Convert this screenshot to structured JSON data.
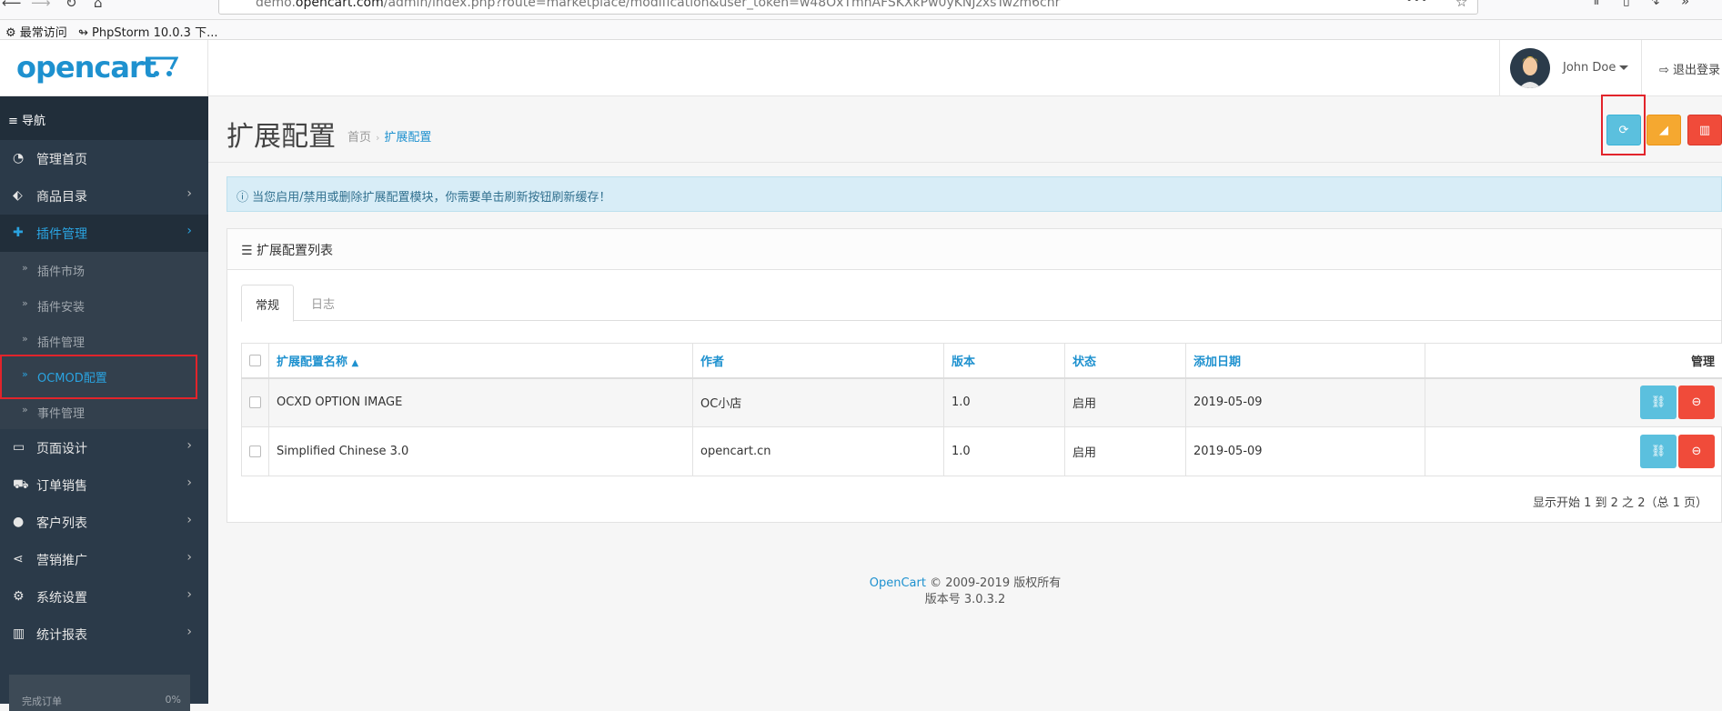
{
  "browser": {
    "url_prefix": "demo.",
    "url_host": "opencart.com",
    "url_path": "/admin/index.php?route=marketplace/modification&user_token=w48OxTmnAFSKXkPw0yKNJzxsTwzm6chr",
    "bookmarks": [
      {
        "label": "最常访问",
        "icon": "gear-icon"
      },
      {
        "label": "PhpStorm 10.0.3 下...",
        "icon": "phpstorm-icon"
      }
    ]
  },
  "header": {
    "logo": "opencart",
    "user_name": "John Doe",
    "logout_label": "退出登录"
  },
  "sidebar": {
    "nav_title": "导航",
    "items": [
      {
        "label": "管理首页",
        "icon": "dashboard-icon",
        "has_children": false
      },
      {
        "label": "商品目录",
        "icon": "tags-icon",
        "has_children": true
      },
      {
        "label": "插件管理",
        "icon": "puzzle-icon",
        "has_children": true,
        "active": true
      },
      {
        "label": "页面设计",
        "icon": "monitor-icon",
        "has_children": true
      },
      {
        "label": "订单销售",
        "icon": "cart-icon",
        "has_children": true
      },
      {
        "label": "客户列表",
        "icon": "user-icon",
        "has_children": true
      },
      {
        "label": "营销推广",
        "icon": "share-icon",
        "has_children": true
      },
      {
        "label": "系统设置",
        "icon": "cog-icon",
        "has_children": true
      },
      {
        "label": "统计报表",
        "icon": "bar-chart-icon",
        "has_children": true
      }
    ],
    "sub_items": [
      {
        "label": "插件市场"
      },
      {
        "label": "插件安装"
      },
      {
        "label": "插件管理"
      },
      {
        "label": "OCMOD配置",
        "current": true
      },
      {
        "label": "事件管理"
      }
    ],
    "progress": {
      "label": "完成订单",
      "percent": "0%",
      "value": 0
    }
  },
  "page": {
    "title": "扩展配置",
    "breadcrumb": [
      "首页",
      "扩展配置"
    ],
    "alert": "当您启用/禁用或删除扩展配置模块，你需要单击刷新按钮刷新缓存！",
    "panel_title": "扩展配置列表",
    "tabs": [
      "常规",
      "日志"
    ],
    "columns": [
      "扩展配置名称",
      "作者",
      "版本",
      "状态",
      "添加日期",
      "管理"
    ],
    "rows": [
      {
        "name": "OCXD OPTION IMAGE",
        "author": "OC小店",
        "version": "1.0",
        "status": "启用",
        "date": "2019-05-09"
      },
      {
        "name": "Simplified Chinese 3.0",
        "author": "opencart.cn",
        "version": "1.0",
        "status": "启用",
        "date": "2019-05-09"
      }
    ],
    "pagination": "显示开始 1 到 2 之 2（总 1 页）"
  },
  "footer": {
    "brand": "OpenCart",
    "copyright": "© 2009-2019 版权所有",
    "version": "版本号 3.0.3.2"
  },
  "colors": {
    "accent": "#1e91cf",
    "sidebar_bg": "#2b3a49",
    "btn_info": "#5bc0de",
    "btn_warning": "#f5a830",
    "btn_danger": "#f04b3a",
    "highlight": "#e2242b"
  }
}
